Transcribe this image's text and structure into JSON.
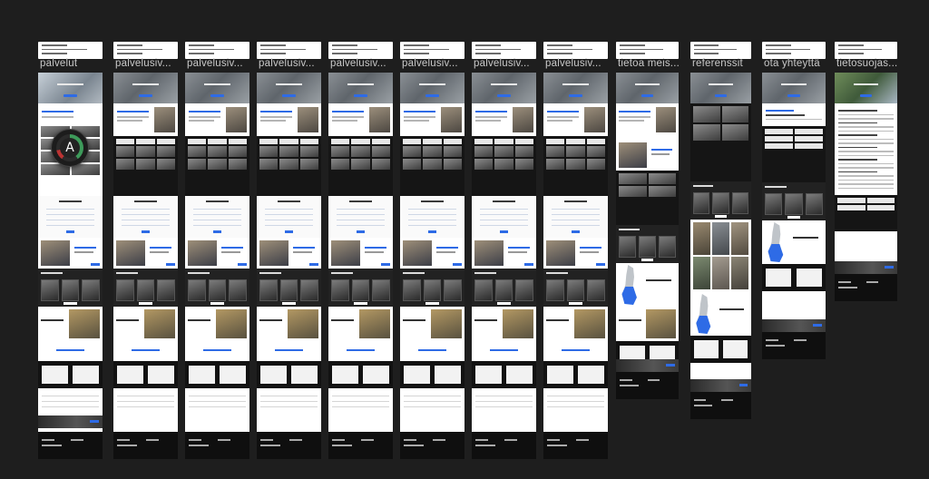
{
  "canvas": {
    "background": "#1e1e1e"
  },
  "accent_color": "#2e6be6",
  "frames": [
    {
      "label": "palvelut"
    },
    {
      "label": "palvelusiv..."
    },
    {
      "label": "palvelusiv..."
    },
    {
      "label": "palvelusiv..."
    },
    {
      "label": "palvelusiv..."
    },
    {
      "label": "palvelusiv..."
    },
    {
      "label": "palvelusiv..."
    },
    {
      "label": "palvelusiv..."
    },
    {
      "label": "tietoa meis..."
    },
    {
      "label": "referenssit"
    },
    {
      "label": "ota yhteyttä"
    },
    {
      "label": "tietosuojas..."
    }
  ],
  "avatar": {
    "initial": "A",
    "icon": "user-avatar-icon"
  }
}
